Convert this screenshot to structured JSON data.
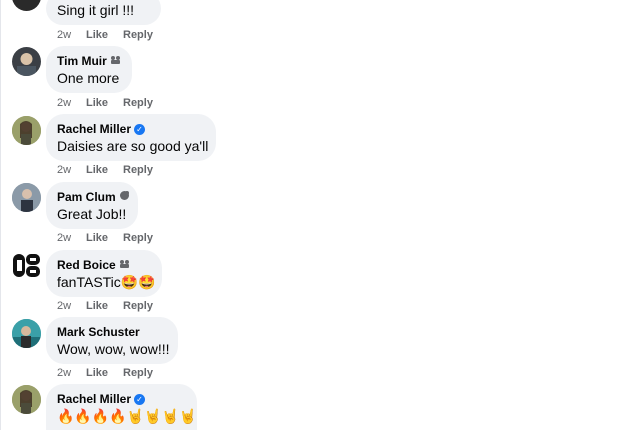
{
  "comments": [
    {
      "author": "",
      "text": "Sing it girl !!!",
      "time": "2w",
      "like": "Like",
      "reply": "Reply",
      "badge": "none"
    },
    {
      "author": "Tim Muir",
      "text": "One more",
      "time": "2w",
      "like": "Like",
      "reply": "Reply",
      "badge": "top-fan-icon"
    },
    {
      "author": "Rachel Miller",
      "text": "Daisies are so good ya'll",
      "time": "2w",
      "like": "Like",
      "reply": "Reply",
      "badge": "verified-badge-icon"
    },
    {
      "author": "Pam Clum",
      "text": "Great Job!!",
      "time": "2w",
      "like": "Like",
      "reply": "Reply",
      "badge": "top-fan-icon"
    },
    {
      "author": "Red Boice",
      "text": "fanTASTic🤩🤩",
      "time": "2w",
      "like": "Like",
      "reply": "Reply",
      "badge": "top-fan-icon"
    },
    {
      "author": "Mark Schuster",
      "text": "Wow, wow, wow!!!",
      "time": "2w",
      "like": "Like",
      "reply": "Reply",
      "badge": "none"
    },
    {
      "author": "Rachel Miller",
      "text": "🔥🔥🔥🔥🤘🤘🤘🤘",
      "time": "",
      "like": "",
      "reply": "",
      "badge": "verified-badge-icon"
    }
  ],
  "colors": {
    "bubble": "#f0f2f5",
    "verified": "#1877f2",
    "secondary_text": "#65676b"
  }
}
